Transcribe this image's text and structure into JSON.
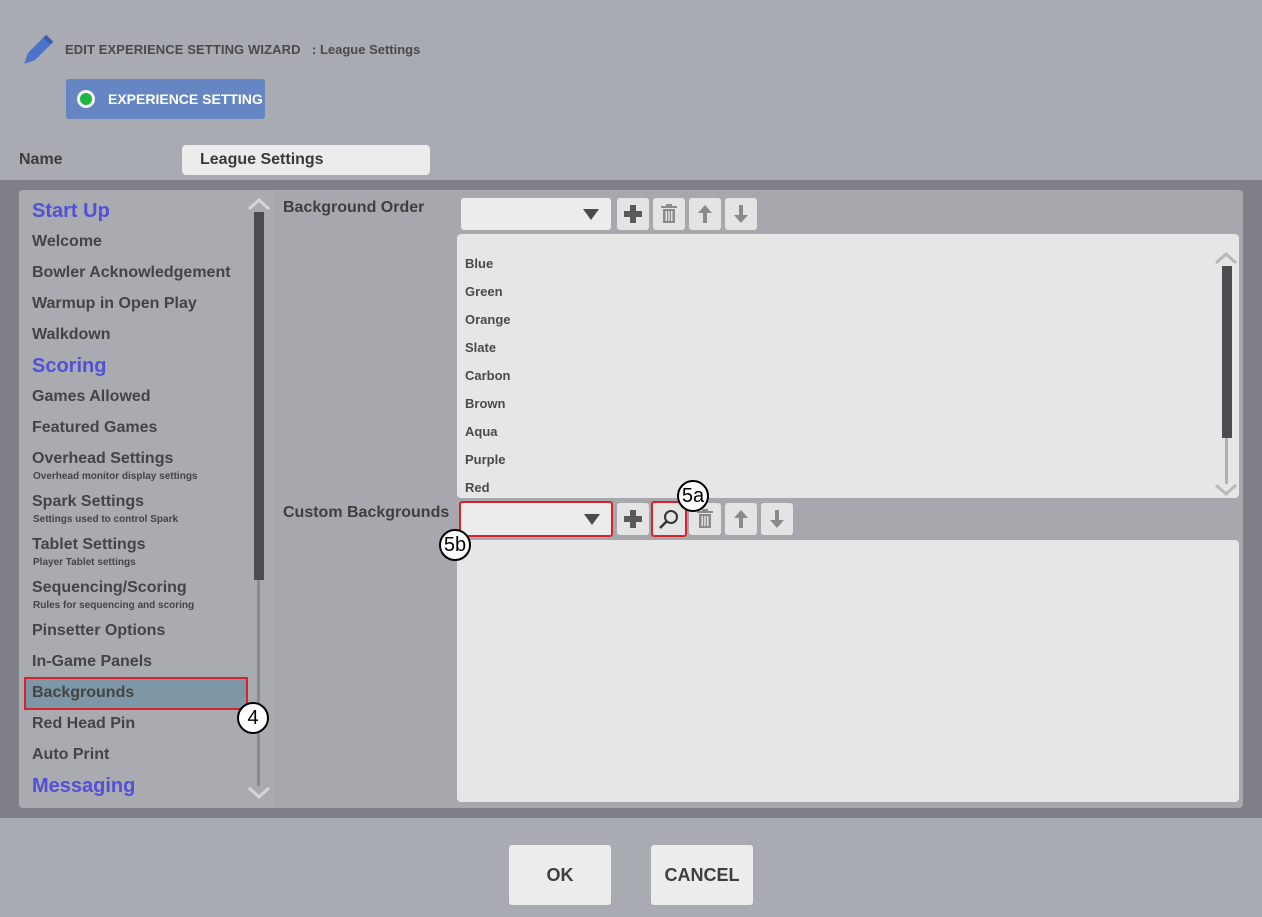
{
  "header": {
    "title": "EDIT EXPERIENCE SETTING WIZARD",
    "subtitle": ": League Settings",
    "mode_button": "EXPERIENCE SETTING"
  },
  "name_field": {
    "label": "Name",
    "value": "League Settings"
  },
  "sidebar": {
    "items": [
      {
        "label": "Start Up",
        "type": "section"
      },
      {
        "label": "Welcome",
        "type": "item"
      },
      {
        "label": "Bowler Acknowledgement",
        "type": "item"
      },
      {
        "label": "Warmup in Open Play",
        "type": "item"
      },
      {
        "label": "Walkdown",
        "type": "item"
      },
      {
        "label": "Scoring",
        "type": "section"
      },
      {
        "label": "Games Allowed",
        "type": "item"
      },
      {
        "label": "Featured Games",
        "type": "item"
      },
      {
        "label": "Overhead Settings",
        "type": "item",
        "sub": "Overhead monitor display settings"
      },
      {
        "label": "Spark Settings",
        "type": "item",
        "sub": "Settings used to control Spark"
      },
      {
        "label": "Tablet Settings",
        "type": "item",
        "sub": "Player Tablet settings"
      },
      {
        "label": "Sequencing/Scoring",
        "type": "item",
        "sub": "Rules for sequencing and scoring"
      },
      {
        "label": "Pinsetter Options",
        "type": "item"
      },
      {
        "label": "In-Game Panels",
        "type": "item"
      },
      {
        "label": "Backgrounds",
        "type": "item",
        "selected": true
      },
      {
        "label": "Red Head Pin",
        "type": "item"
      },
      {
        "label": "Auto Print",
        "type": "item"
      },
      {
        "label": "Messaging",
        "type": "section"
      }
    ]
  },
  "background_order": {
    "label": "Background Order",
    "items": [
      "Blue",
      "Green",
      "Orange",
      "Slate",
      "Carbon",
      "Brown",
      "Aqua",
      "Purple",
      "Red"
    ]
  },
  "custom_backgrounds": {
    "label": "Custom Backgrounds",
    "items": []
  },
  "callouts": {
    "c4": "4",
    "c5a": "5a",
    "c5b": "5b"
  },
  "footer": {
    "ok": "OK",
    "cancel": "CANCEL"
  },
  "colors": {
    "background": "#a9abb3",
    "accent": "#6685c3",
    "section": "#5250d6",
    "selected": "#7d97a6",
    "highlight": "#d8232a",
    "status": "#20b440"
  }
}
